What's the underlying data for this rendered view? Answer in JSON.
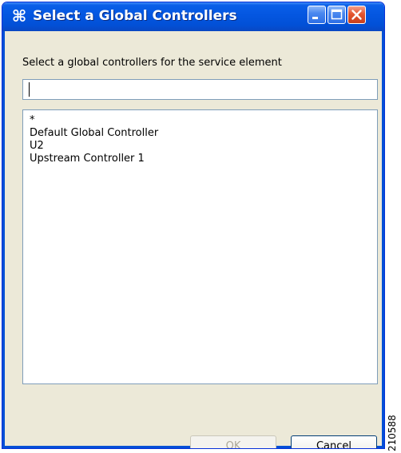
{
  "window": {
    "title": "Select a Global Controllers",
    "app_icon": "command-key-icon",
    "title_buttons": [
      "minimize-icon",
      "maximize-icon",
      "close-icon"
    ]
  },
  "dialog": {
    "prompt": "Select a global controllers for the service element",
    "filter": {
      "value": "",
      "placeholder": ""
    },
    "items": [
      "*",
      "Default Global Controller",
      "U2",
      "Upstream Controller 1"
    ],
    "ok_label": "OK",
    "cancel_label": "Cancel",
    "ok_enabled": false
  },
  "figure_id": "210588",
  "colors": {
    "titlebar": "#0456e0",
    "frame": "#0250d6",
    "dialog_bg": "#ece9d8",
    "close_button": "#e4552f",
    "input_border": "#7f9db9",
    "disabled_text": "#aca899"
  }
}
